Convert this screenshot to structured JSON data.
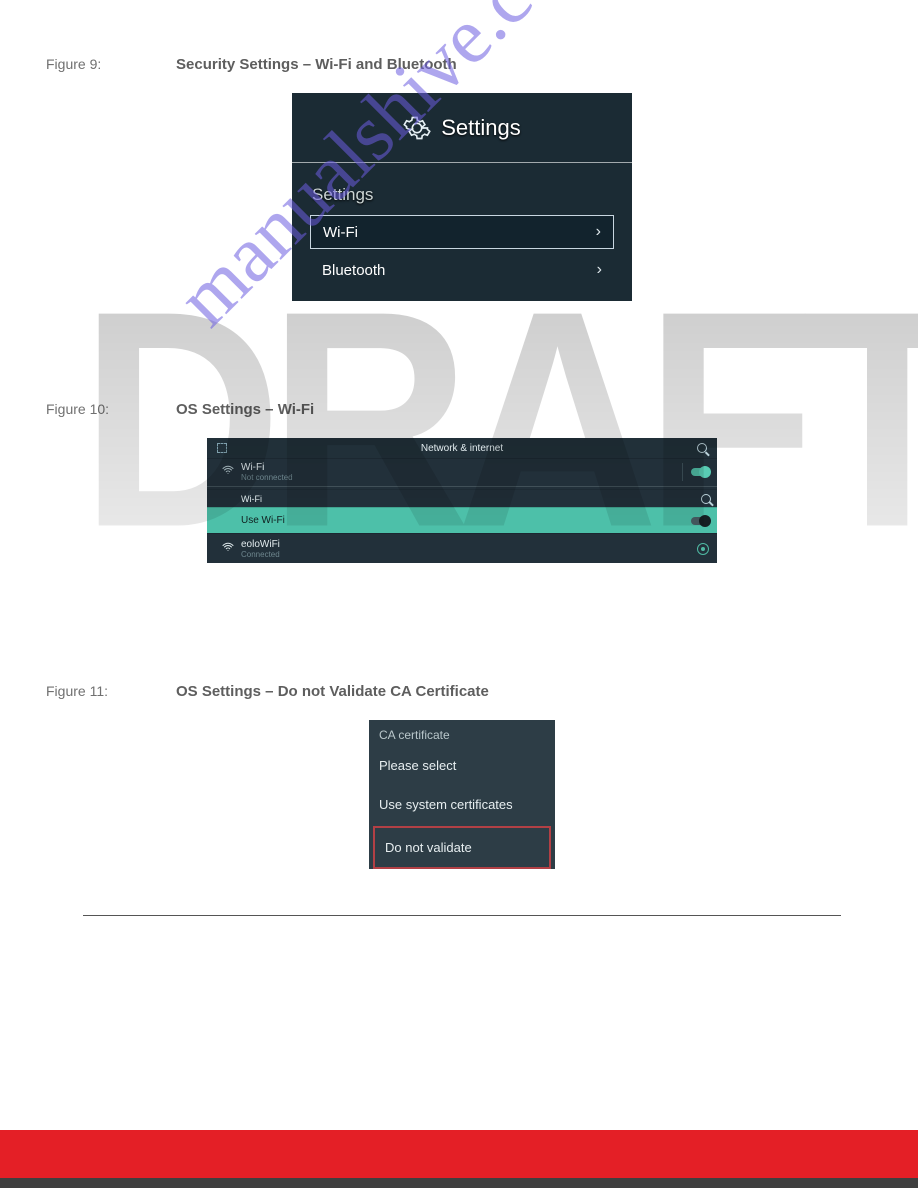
{
  "watermarks": {
    "draft": "DRAFT",
    "site": "manualshive.com"
  },
  "figures": {
    "fig9": {
      "label": "Figure 9:",
      "caption": "Security Settings – Wi-Fi and Bluetooth",
      "header_title": "Settings",
      "subheader": "Settings",
      "items": [
        {
          "label": "Wi-Fi",
          "selected": true
        },
        {
          "label": "Bluetooth",
          "selected": false
        }
      ]
    },
    "fig10": {
      "label": "Figure 10:",
      "caption": "OS Settings – Wi-Fi",
      "top_title": "Network & internet",
      "wifi_row": {
        "label": "Wi-Fi",
        "sub": "Not connected"
      },
      "section_label": "Wi-Fi",
      "use_wifi": "Use Wi-Fi",
      "connected_row": {
        "label": "eoloWiFi",
        "sub": "Connected"
      }
    },
    "fig11": {
      "label": "Figure 11:",
      "caption": "OS Settings – Do not Validate CA Certificate",
      "title": "CA certificate",
      "please_select": "Please select",
      "use_system": "Use system certificates",
      "do_not_validate": "Do not validate"
    }
  }
}
